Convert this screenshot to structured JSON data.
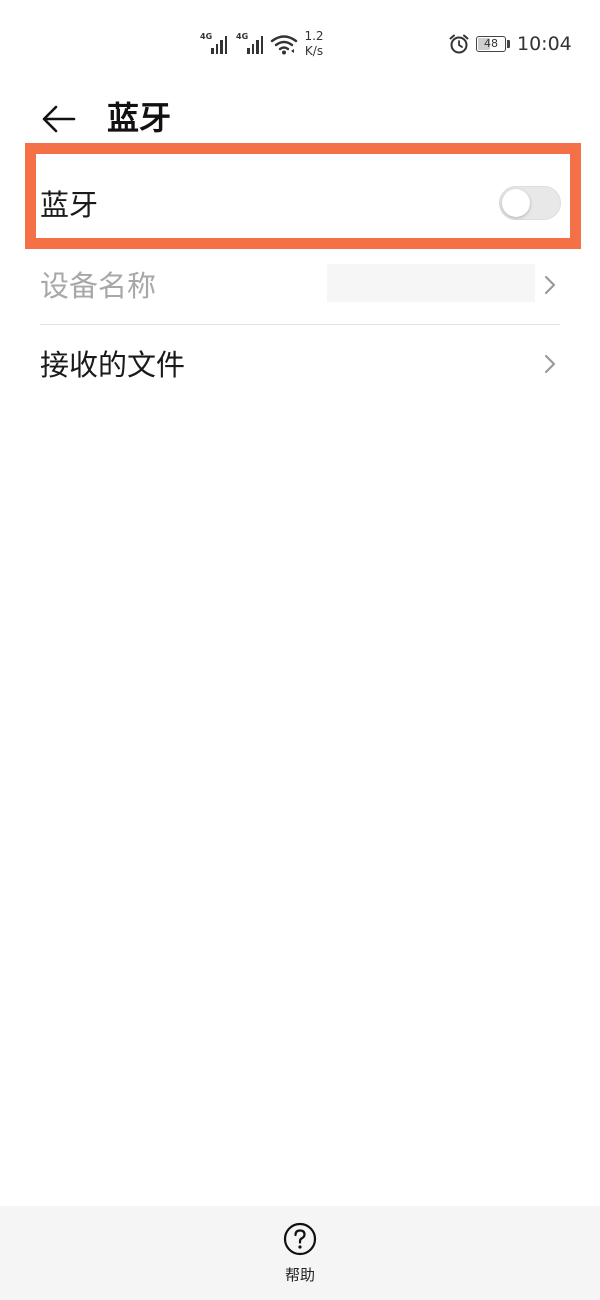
{
  "status_bar": {
    "signal_1_tag": "4G",
    "signal_2_tag": "4G",
    "net_speed_value": "1.2",
    "net_speed_unit": "K/s",
    "battery_level": "48",
    "battery_fraction": 0.48,
    "time": "10:04",
    "icons": {
      "signal": "cellular-signal-icon",
      "wifi": "wifi-icon",
      "alarm": "alarm-clock-icon",
      "battery": "battery-icon"
    }
  },
  "header": {
    "back_icon": "arrow-left-icon",
    "title": "蓝牙"
  },
  "settings": {
    "bluetooth": {
      "label": "蓝牙",
      "enabled": false
    },
    "device_name": {
      "label": "设备名称",
      "value": ""
    },
    "received_files": {
      "label": "接收的文件"
    },
    "chevron_icon": "chevron-right-icon"
  },
  "bottom": {
    "help_icon": "question-circle-icon",
    "help_label": "帮助"
  },
  "colors": {
    "highlight": "#f47147",
    "toggle_off_track": "#e8e8e8",
    "disabled_text": "#a8a8a8",
    "bottom_bar": "#f5f5f5"
  }
}
